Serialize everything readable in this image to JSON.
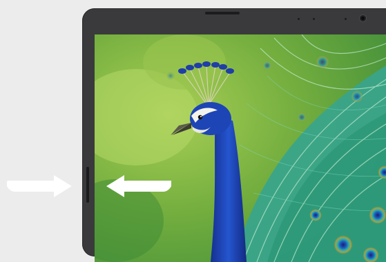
{
  "scene": {
    "subject_icon": "peacock-image",
    "left_arrow_icon": "arrow-right-icon",
    "right_arrow_icon": "arrow-left-icon"
  },
  "colors": {
    "background": "#ececec",
    "device_bezel": "#3a3a3c",
    "arrow": "#ffffff",
    "peacock_blue": "#1e45b8",
    "foliage_green": "#6fa83a",
    "feather_teal": "#36b5a0"
  }
}
